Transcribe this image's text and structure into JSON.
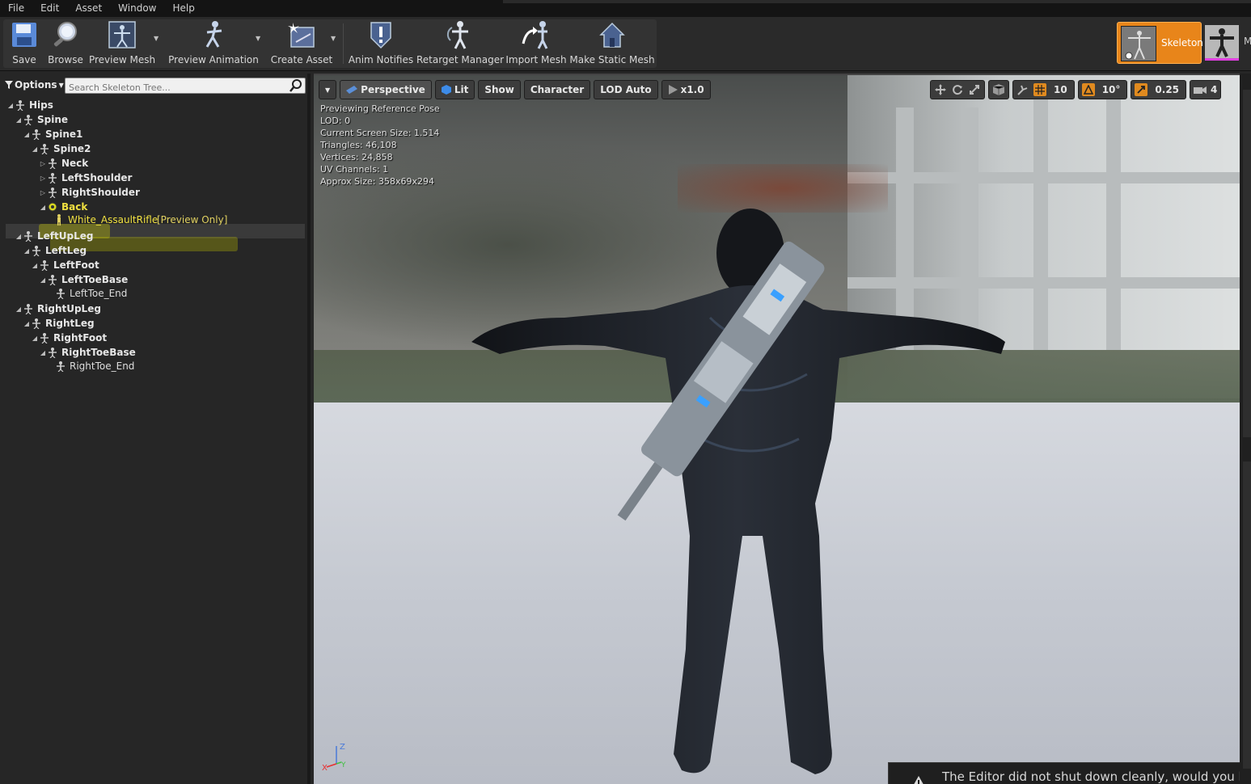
{
  "menu": [
    "File",
    "Edit",
    "Asset",
    "Window",
    "Help"
  ],
  "toolbar": {
    "save": "Save",
    "browse": "Browse",
    "preview_mesh": "Preview Mesh",
    "preview_animation": "Preview Animation",
    "create_asset": "Create Asset",
    "anim_notifies": "Anim Notifies",
    "retarget_manager": "Retarget Manager",
    "import_mesh": "Import Mesh",
    "make_static_mesh": "Make Static Mesh"
  },
  "modes": {
    "skeleton": "Skeleton",
    "mesh_partial": "M"
  },
  "skeleton_tree": {
    "options_label": "Options",
    "search_placeholder": "Search Skeleton Tree...",
    "bones": [
      {
        "label": "Hips"
      },
      {
        "label": "Spine"
      },
      {
        "label": "Spine1"
      },
      {
        "label": "Spine2"
      },
      {
        "label": "Neck"
      },
      {
        "label": "LeftShoulder"
      },
      {
        "label": "RightShoulder"
      },
      {
        "label": "Back"
      },
      {
        "label": "White_AssaultRifle",
        "suffix": "[Preview Only]"
      },
      {
        "label": "LeftUpLeg"
      },
      {
        "label": "LeftLeg"
      },
      {
        "label": "LeftFoot"
      },
      {
        "label": "LeftToeBase"
      },
      {
        "label": "LeftToe_End"
      },
      {
        "label": "RightUpLeg"
      },
      {
        "label": "RightLeg"
      },
      {
        "label": "RightFoot"
      },
      {
        "label": "RightToeBase"
      },
      {
        "label": "RightToe_End"
      }
    ]
  },
  "viewport": {
    "perspective": "Perspective",
    "lit": "Lit",
    "show": "Show",
    "character": "Character",
    "lod": "LOD Auto",
    "speed": "x1.0",
    "grid_snap": "10",
    "rot_snap": "10°",
    "scale_snap": "0.25",
    "camera_speed": "4",
    "stats": [
      "Previewing Reference Pose",
      "LOD: 0",
      "Current Screen Size: 1.514",
      "Triangles: 46,108",
      "Vertices: 24,858",
      "UV Channels: 1",
      "Approx Size: 358x69x294"
    ]
  },
  "toast": {
    "message": "The Editor did not shut down cleanly, would you like to"
  },
  "colors": {
    "accent_orange": "#e8851a",
    "highlight_yellow": "#d2d200",
    "preview_only_text": "#e0d060"
  }
}
